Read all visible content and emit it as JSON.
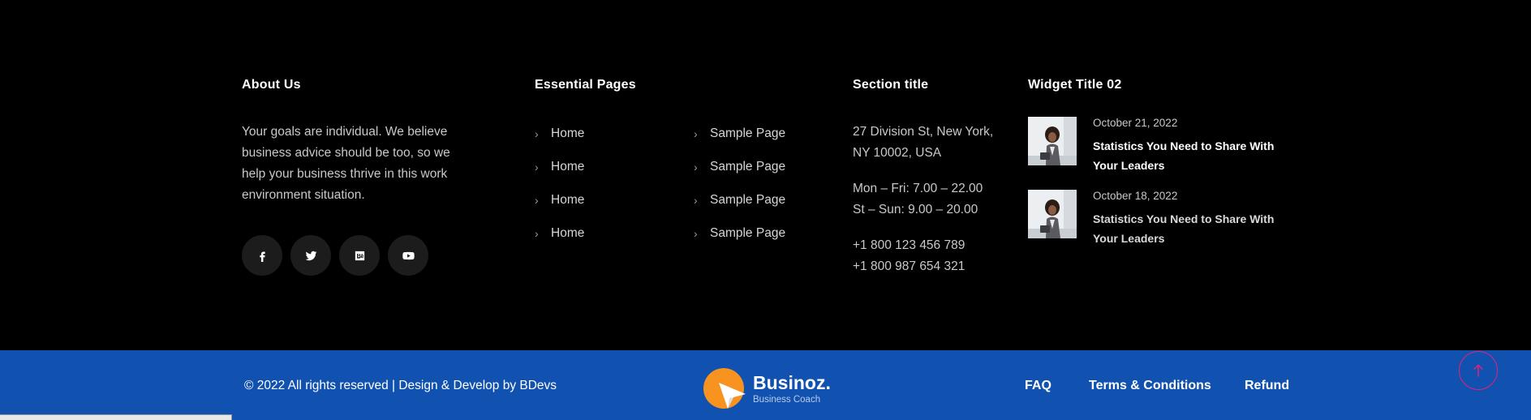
{
  "about": {
    "title": "About Us",
    "text": "Your goals are individual. We believe business advice should be too, so we help your business thrive in this work environment situation.",
    "socials": [
      {
        "icon": "facebook-icon"
      },
      {
        "icon": "twitter-icon"
      },
      {
        "icon": "behance-icon"
      },
      {
        "icon": "youtube-icon"
      }
    ]
  },
  "pages": {
    "title": "Essential Pages",
    "col1": [
      "Home",
      "Home",
      "Home",
      "Home"
    ],
    "col2": [
      "Sample Page",
      "Sample Page",
      "Sample Page",
      "Sample Page"
    ]
  },
  "section": {
    "title": "Section title",
    "address": [
      "27 Division St, New York,",
      "NY 10002, USA"
    ],
    "hours": [
      "Mon – Fri: 7.00 – 22.00",
      "St – Sun: 9.00 – 20.00"
    ],
    "phones": [
      "+1 800 123 456 789",
      "+1 800 987 654 321"
    ]
  },
  "widget": {
    "title": "Widget Title 02",
    "posts": [
      {
        "date": "October 21, 2022",
        "title": "Statistics You Need to Share With Your Leaders"
      },
      {
        "date": "October 18, 2022",
        "title": "Statistics You Need to Share With Your Leaders"
      }
    ]
  },
  "bottom": {
    "copyright": "© 2022 All rights reserved | Design & Develop by BDevs",
    "brand_name": "Businoz.",
    "brand_tagline": "Business Coach",
    "links": [
      "FAQ",
      "Terms & Conditions",
      "Refund"
    ]
  },
  "colors": {
    "background": "#000000",
    "bottom_bar": "#1152b1",
    "brand_orange": "#f7931e",
    "scroll_top_accent": "#e4217a"
  }
}
